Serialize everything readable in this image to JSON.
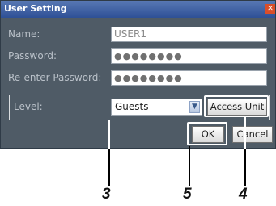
{
  "dialog": {
    "title": "User Setting",
    "close_glyph": "✕",
    "fields": [
      {
        "label": "Name:",
        "value": "USER1"
      },
      {
        "label": "Password:",
        "value": "●●●●●●●●"
      },
      {
        "label": "Re-enter Password:",
        "value": "●●●●●●●●"
      }
    ],
    "level": {
      "label": "Level:",
      "selected": "Guests",
      "arrow": "▼"
    },
    "buttons": {
      "access_unit": "Access Unit",
      "ok": "OK",
      "cancel": "Cancel"
    }
  },
  "callouts": {
    "level_area": "3",
    "ok_button": "5",
    "access_unit_button": "4"
  }
}
